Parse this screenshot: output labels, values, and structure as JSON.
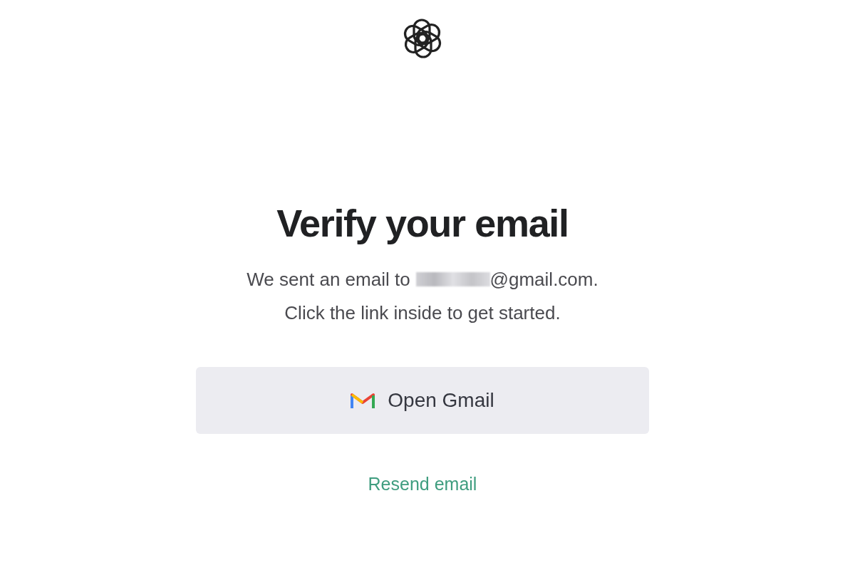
{
  "heading": "Verify your email",
  "message": {
    "prefix": "We sent an email to",
    "redacted": true,
    "suffix": "@gmail.com.",
    "line_2": "Click the link inside to get started."
  },
  "open_button": {
    "label": "Open Gmail"
  },
  "resend_link": "Resend email"
}
